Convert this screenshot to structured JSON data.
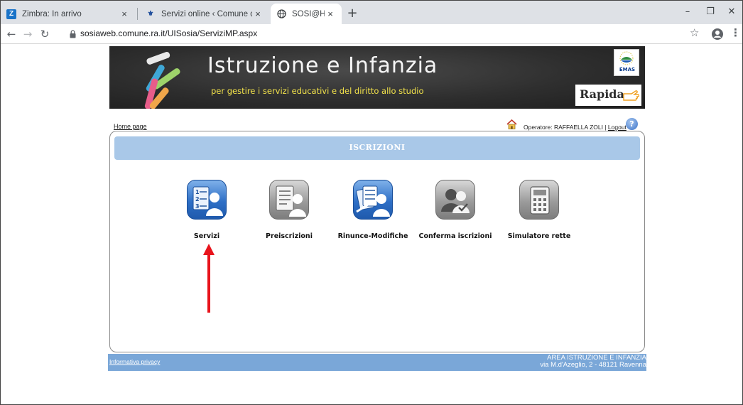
{
  "browser": {
    "tabs": [
      {
        "title": "Zimbra: In arrivo",
        "icon": "zimbra-icon"
      },
      {
        "title": "Servizi online ‹ Comune di Raven",
        "icon": "comune-icon"
      },
      {
        "title": "SOSI@HOME - Softech srl",
        "icon": "globe-icon"
      }
    ],
    "url": "sosiaweb.comune.ra.it/UISosia/ServiziMP.aspx",
    "new_tab": "+",
    "close_glyph": "×"
  },
  "banner": {
    "title": "Istruzione e Infanzia",
    "subtitle": "per gestire i servizi educativi e del diritto allo studio",
    "emas_label": "EMAS",
    "rapida_label": "Rapida"
  },
  "nav": {
    "home_link": "Home page",
    "operator_label": "Operatore: RAFFAELLA ZOLI",
    "separator": " | ",
    "logout": "Logout"
  },
  "panel": {
    "title": "ISCRIZIONI",
    "services": [
      {
        "label": "Servizi",
        "style": "blue"
      },
      {
        "label": "Preiscrizioni",
        "style": "grey"
      },
      {
        "label": "Rinunce-Modifiche",
        "style": "blue"
      },
      {
        "label": "Conferma iscrizioni",
        "style": "grey"
      },
      {
        "label": "Simulatore rette",
        "style": "grey"
      }
    ]
  },
  "footer": {
    "privacy": "Informativa privacy",
    "address_line1": "AREA ISTRUZIONE E INFANZIA",
    "address_line2": "via M.d'Azeglio, 2 - 48121 Ravenna"
  },
  "colors": {
    "header_bar": "#a9c8e8",
    "footer_bar": "#7aa7d8",
    "arrow": "#e8141c",
    "subtitle": "#f2e24a"
  }
}
